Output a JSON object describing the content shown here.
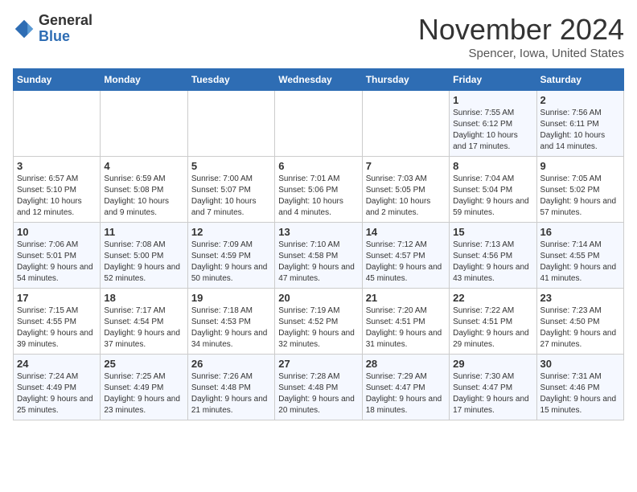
{
  "logo": {
    "general": "General",
    "blue": "Blue"
  },
  "title": "November 2024",
  "location": "Spencer, Iowa, United States",
  "days_of_week": [
    "Sunday",
    "Monday",
    "Tuesday",
    "Wednesday",
    "Thursday",
    "Friday",
    "Saturday"
  ],
  "weeks": [
    [
      {
        "day": "",
        "info": ""
      },
      {
        "day": "",
        "info": ""
      },
      {
        "day": "",
        "info": ""
      },
      {
        "day": "",
        "info": ""
      },
      {
        "day": "",
        "info": ""
      },
      {
        "day": "1",
        "info": "Sunrise: 7:55 AM\nSunset: 6:12 PM\nDaylight: 10 hours and 17 minutes."
      },
      {
        "day": "2",
        "info": "Sunrise: 7:56 AM\nSunset: 6:11 PM\nDaylight: 10 hours and 14 minutes."
      }
    ],
    [
      {
        "day": "3",
        "info": "Sunrise: 6:57 AM\nSunset: 5:10 PM\nDaylight: 10 hours and 12 minutes."
      },
      {
        "day": "4",
        "info": "Sunrise: 6:59 AM\nSunset: 5:08 PM\nDaylight: 10 hours and 9 minutes."
      },
      {
        "day": "5",
        "info": "Sunrise: 7:00 AM\nSunset: 5:07 PM\nDaylight: 10 hours and 7 minutes."
      },
      {
        "day": "6",
        "info": "Sunrise: 7:01 AM\nSunset: 5:06 PM\nDaylight: 10 hours and 4 minutes."
      },
      {
        "day": "7",
        "info": "Sunrise: 7:03 AM\nSunset: 5:05 PM\nDaylight: 10 hours and 2 minutes."
      },
      {
        "day": "8",
        "info": "Sunrise: 7:04 AM\nSunset: 5:04 PM\nDaylight: 9 hours and 59 minutes."
      },
      {
        "day": "9",
        "info": "Sunrise: 7:05 AM\nSunset: 5:02 PM\nDaylight: 9 hours and 57 minutes."
      }
    ],
    [
      {
        "day": "10",
        "info": "Sunrise: 7:06 AM\nSunset: 5:01 PM\nDaylight: 9 hours and 54 minutes."
      },
      {
        "day": "11",
        "info": "Sunrise: 7:08 AM\nSunset: 5:00 PM\nDaylight: 9 hours and 52 minutes."
      },
      {
        "day": "12",
        "info": "Sunrise: 7:09 AM\nSunset: 4:59 PM\nDaylight: 9 hours and 50 minutes."
      },
      {
        "day": "13",
        "info": "Sunrise: 7:10 AM\nSunset: 4:58 PM\nDaylight: 9 hours and 47 minutes."
      },
      {
        "day": "14",
        "info": "Sunrise: 7:12 AM\nSunset: 4:57 PM\nDaylight: 9 hours and 45 minutes."
      },
      {
        "day": "15",
        "info": "Sunrise: 7:13 AM\nSunset: 4:56 PM\nDaylight: 9 hours and 43 minutes."
      },
      {
        "day": "16",
        "info": "Sunrise: 7:14 AM\nSunset: 4:55 PM\nDaylight: 9 hours and 41 minutes."
      }
    ],
    [
      {
        "day": "17",
        "info": "Sunrise: 7:15 AM\nSunset: 4:55 PM\nDaylight: 9 hours and 39 minutes."
      },
      {
        "day": "18",
        "info": "Sunrise: 7:17 AM\nSunset: 4:54 PM\nDaylight: 9 hours and 37 minutes."
      },
      {
        "day": "19",
        "info": "Sunrise: 7:18 AM\nSunset: 4:53 PM\nDaylight: 9 hours and 34 minutes."
      },
      {
        "day": "20",
        "info": "Sunrise: 7:19 AM\nSunset: 4:52 PM\nDaylight: 9 hours and 32 minutes."
      },
      {
        "day": "21",
        "info": "Sunrise: 7:20 AM\nSunset: 4:51 PM\nDaylight: 9 hours and 31 minutes."
      },
      {
        "day": "22",
        "info": "Sunrise: 7:22 AM\nSunset: 4:51 PM\nDaylight: 9 hours and 29 minutes."
      },
      {
        "day": "23",
        "info": "Sunrise: 7:23 AM\nSunset: 4:50 PM\nDaylight: 9 hours and 27 minutes."
      }
    ],
    [
      {
        "day": "24",
        "info": "Sunrise: 7:24 AM\nSunset: 4:49 PM\nDaylight: 9 hours and 25 minutes."
      },
      {
        "day": "25",
        "info": "Sunrise: 7:25 AM\nSunset: 4:49 PM\nDaylight: 9 hours and 23 minutes."
      },
      {
        "day": "26",
        "info": "Sunrise: 7:26 AM\nSunset: 4:48 PM\nDaylight: 9 hours and 21 minutes."
      },
      {
        "day": "27",
        "info": "Sunrise: 7:28 AM\nSunset: 4:48 PM\nDaylight: 9 hours and 20 minutes."
      },
      {
        "day": "28",
        "info": "Sunrise: 7:29 AM\nSunset: 4:47 PM\nDaylight: 9 hours and 18 minutes."
      },
      {
        "day": "29",
        "info": "Sunrise: 7:30 AM\nSunset: 4:47 PM\nDaylight: 9 hours and 17 minutes."
      },
      {
        "day": "30",
        "info": "Sunrise: 7:31 AM\nSunset: 4:46 PM\nDaylight: 9 hours and 15 minutes."
      }
    ]
  ]
}
